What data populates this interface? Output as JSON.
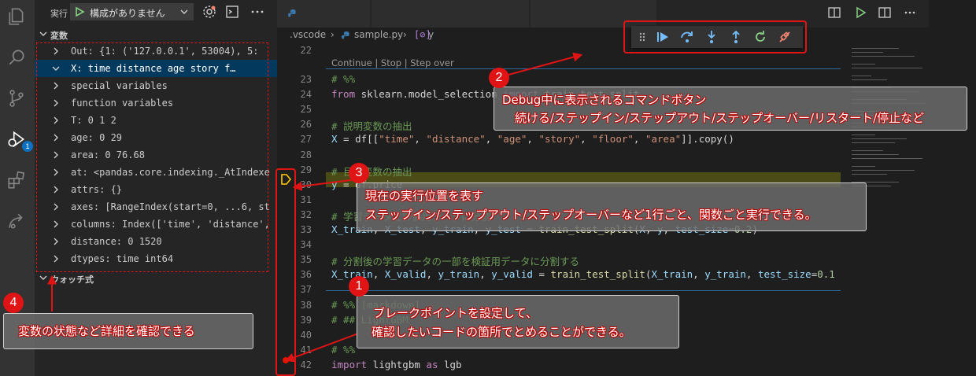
{
  "run_bar": {
    "label": "実行",
    "config": "構成がありません"
  },
  "sections": {
    "variables": "変数",
    "watch": "ウォッチ式"
  },
  "variables": [
    {
      "text": "Out: {1: ('127.0.0.1', 53004), 5:",
      "expanded": false
    },
    {
      "text": "X:      time  distance  age  story  f…",
      "expanded": true
    },
    {
      "text": "special variables",
      "expanded": false
    },
    {
      "text": "function variables",
      "expanded": false
    },
    {
      "text": "T:             0         1       2",
      "expanded": false
    },
    {
      "text": "age: 0      29",
      "expanded": false
    },
    {
      "text": "area: 0     76.68",
      "expanded": false
    },
    {
      "text": "at: <pandas.core.indexing._AtIndexe",
      "expanded": false
    },
    {
      "text": "attrs: {}",
      "expanded": false
    },
    {
      "text": "axes: [RangeIndex(start=0, ...6, st",
      "expanded": false
    },
    {
      "text": "columns: Index(['time', 'distance',",
      "expanded": false
    },
    {
      "text": "distance: 0     1520",
      "expanded": false
    },
    {
      "text": "dtypes: time          int64",
      "expanded": false
    }
  ],
  "breadcrumb": {
    "folder": ".vscode",
    "file": "sample.py",
    "symbol": "y"
  },
  "editor": {
    "codelens": "Continue | Stop | Step over",
    "lines": [
      {
        "num": "22",
        "html": ""
      },
      {
        "num": "23",
        "html": "<span class='cm'># %%</span>"
      },
      {
        "num": "24",
        "html": "<span class='kw'>from</span> sklearn.model_selection <span class='kw'>import</span> train_test_split"
      },
      {
        "num": "25",
        "html": ""
      },
      {
        "num": "26",
        "html": "<span class='cm'># 説明変数の抽出</span>"
      },
      {
        "num": "27",
        "html": "<span class='var'>X</span> = df[[<span class='str'>\"time\"</span>, <span class='str'>\"distance\"</span>, <span class='str'>\"age\"</span>, <span class='str'>\"story\"</span>, <span class='str'>\"floor\"</span>, <span class='str'>\"area\"</span>]].copy()"
      },
      {
        "num": "28",
        "html": ""
      },
      {
        "num": "29",
        "html": "<span class='cm'># 目的変数の抽出</span>"
      },
      {
        "num": "30",
        "html": "<span class='var'>y</span> = df.price"
      },
      {
        "num": "31",
        "html": ""
      },
      {
        "num": "32",
        "html": "<span class='cm'># 学習データと評価用データに分割</span>"
      },
      {
        "num": "33",
        "html": "<span class='var'>X_train</span>, <span class='var'>X_test</span>, <span class='var'>y_train</span>, <span class='var'>y_test</span> = <span class='fn'>train_test_split</span>(<span class='var'>X</span>, <span class='var'>y</span>, <span class='var'>test_size</span>=<span class='num'>0.2</span>)"
      },
      {
        "num": "34",
        "html": ""
      },
      {
        "num": "35",
        "html": "<span class='cm'># 分割後の学習データの一部を検証用データに分割する</span>"
      },
      {
        "num": "36",
        "html": "<span class='var'>X_train</span>, <span class='var'>X_valid</span>, <span class='var'>y_train</span>, <span class='var'>y_valid</span> = <span class='fn'>train_test_split</span>(<span class='var'>X_train</span>, <span class='var'>y_train</span>, <span class='var'>test_size</span>=<span class='num'>0.1</span>"
      },
      {
        "num": "37",
        "html": ""
      },
      {
        "num": "38",
        "html": "<span class='cm'># %% [markdown]</span>"
      },
      {
        "num": "39",
        "html": "<span class='cm'># ## LightGBM</span>"
      },
      {
        "num": "40",
        "html": ""
      },
      {
        "num": "41",
        "html": "<span class='cm'># %%</span>"
      },
      {
        "num": "42",
        "html": "<span class='kw'>import</span> lightgbm <span class='kw'>as</span> lgb"
      },
      {
        "num": "43",
        "html": ""
      }
    ]
  },
  "annotations": {
    "n1": "1",
    "n2": "2",
    "n3": "3",
    "n4": "4",
    "c1_line1": "ブレークポイントを設定して、",
    "c1_line2": "確認したいコードの箇所でとめることができる。",
    "c2_line1": "Debug中に表示されるコマンドボタン",
    "c2_line2": "続ける/ステップイン/ステップアウト/ステップオーバー/リスタート/停止など",
    "c3_line1": "現在の実行位置を表す",
    "c3_line2": "ステップイン/ステップアウト/ステップオーバーなど1行ごと、関数ごと実行できる。",
    "c4_line1": "変数の状態など詳細を確認できる"
  },
  "colors": {
    "annotation_red": "#e01414",
    "selection": "#04395e",
    "accent_blue": "#0e70c0",
    "debug_play": "#75beff",
    "restart_green": "#89d185",
    "disconnect_red": "#f48771"
  }
}
